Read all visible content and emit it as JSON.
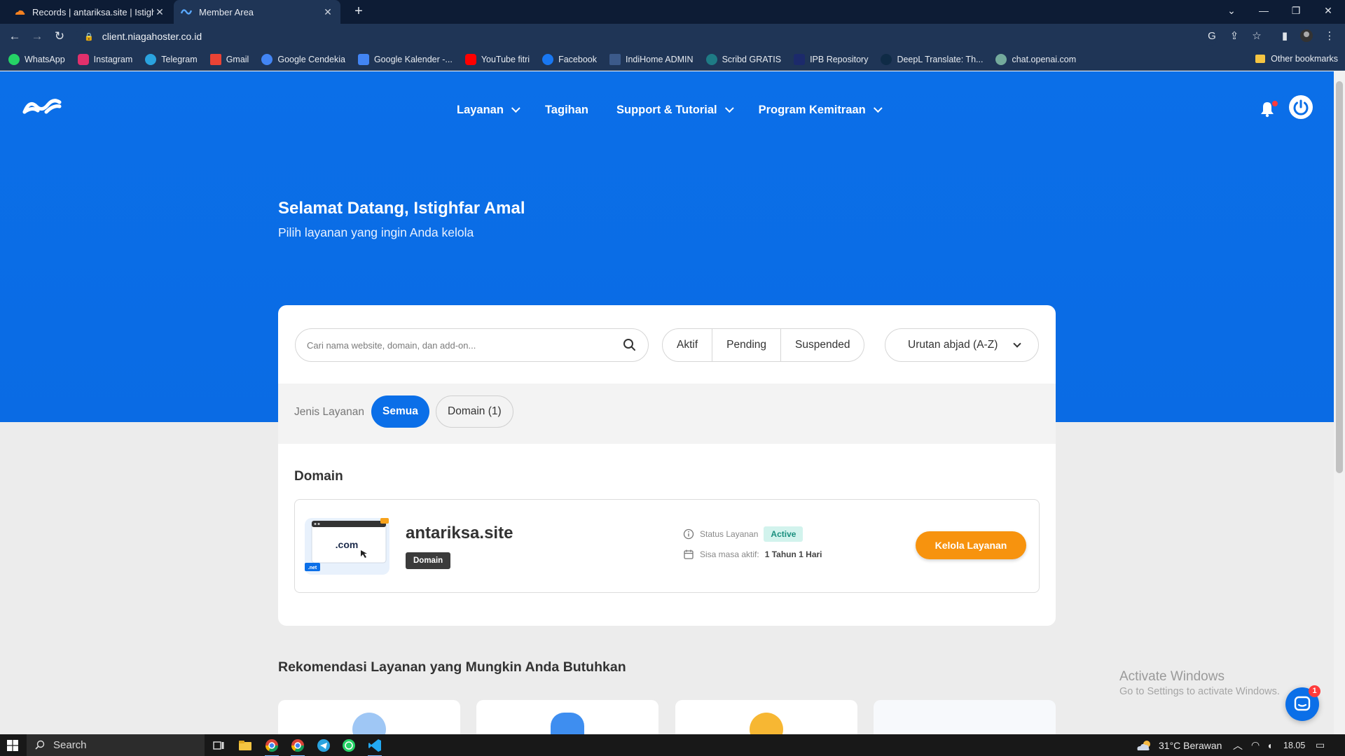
{
  "browser": {
    "tabs": [
      {
        "title": "Records | antariksa.site | Istighfar",
        "active": false
      },
      {
        "title": "Member Area",
        "active": true
      }
    ],
    "url": "client.niagahoster.co.id",
    "bookmarks": [
      "WhatsApp",
      "Instagram",
      "Telegram",
      "Gmail",
      "Google Cendekia",
      "Google Kalender -...",
      "YouTube fitri",
      "Facebook",
      "IndiHome ADMIN",
      "Scribd GRATIS",
      "IPB Repository",
      "DeepL Translate: Th...",
      "chat.openai.com"
    ],
    "other_bookmarks": "Other bookmarks"
  },
  "nav": {
    "items": [
      "Layanan",
      "Tagihan",
      "Support & Tutorial",
      "Program Kemitraan"
    ]
  },
  "hero": {
    "title": "Selamat Datang, Istighfar Amal",
    "subtitle": "Pilih layanan yang ingin Anda kelola"
  },
  "filters": {
    "search_placeholder": "Cari nama website, domain, dan add-on...",
    "status": [
      "Aktif",
      "Pending",
      "Suspended"
    ],
    "sort": "Urutan abjad (A-Z)",
    "type_label": "Jenis Layanan",
    "type_all": "Semua",
    "type_domain": "Domain (1)"
  },
  "section": {
    "title": "Domain",
    "item": {
      "thumb_text": ".com",
      "thumb_tag": ".net",
      "name": "antariksa.site",
      "type": "Domain",
      "status_label": "Status Layanan",
      "status_value": "Active",
      "remaining_label": "Sisa masa aktif:",
      "remaining_value": "1 Tahun 1 Hari",
      "action": "Kelola Layanan"
    }
  },
  "recommend": {
    "title": "Rekomendasi Layanan yang Mungkin Anda Butuhkan"
  },
  "watermark": {
    "line1": "Activate Windows",
    "line2": "Go to Settings to activate Windows."
  },
  "chat": {
    "count": "1"
  },
  "taskbar": {
    "search": "Search",
    "weather": "31°C  Berawan",
    "time": "18.05"
  },
  "colors": {
    "hero_blue": "#0b6fe8",
    "chrome_dark": "#0d1c35",
    "chrome": "#1f3556",
    "accent_orange": "#f7930e",
    "active_badge_bg": "#d2f3ed",
    "active_badge_text": "#1a8f7e"
  }
}
